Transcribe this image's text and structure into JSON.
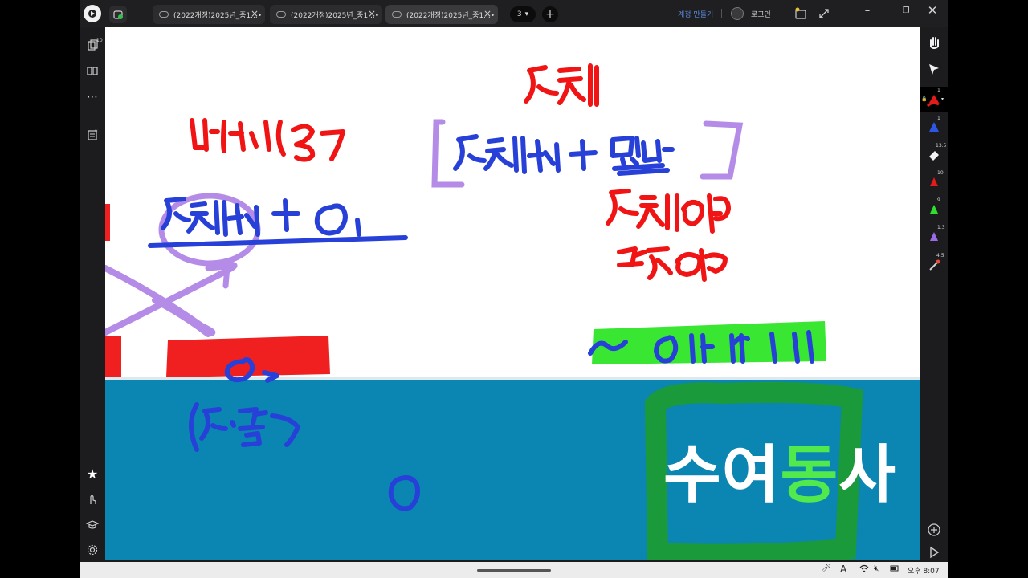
{
  "tabs": [
    {
      "label": "(2022개정)2025년_중1...•"
    },
    {
      "label": "(2022개정)2025년_중1...•"
    },
    {
      "label": "(2022개정)2025년_중1...•"
    }
  ],
  "tab_count": "3",
  "header": {
    "create_account": "계정 만들기",
    "login": "로그인"
  },
  "left_toolbar": {
    "pages_badge": "10"
  },
  "right_toolbar": {
    "pen_red_size": "1",
    "pen_blue_size": "1",
    "eraser_size": "13.5",
    "pen_red2_size": "10",
    "pen_green_size": "9",
    "pen_purple_size": "1.3",
    "laser_size": "4.5"
  },
  "slide": {
    "big_text_white": "수여",
    "big_text_green": "동",
    "big_text_white2": "사"
  },
  "status": {
    "time": "오후 8:07"
  },
  "colors": {
    "ink_red": "#f01414",
    "ink_blue": "#2741d8",
    "ink_purple": "#b48be6",
    "ink_green": "#39e632",
    "slide_blue": "#0b86b2",
    "box_green": "#1a9a3a"
  }
}
